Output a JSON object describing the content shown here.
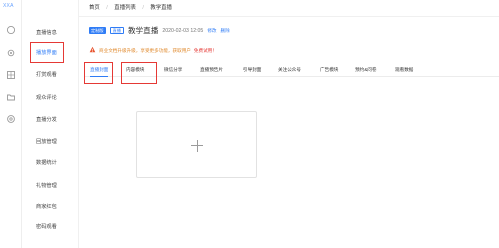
{
  "app": {
    "logo_text": "XXA"
  },
  "rail_icons": [
    "home-icon",
    "gear-icon",
    "grid-icon",
    "folder-icon",
    "settings-icon"
  ],
  "menu": {
    "items": [
      {
        "label": "直播信息"
      },
      {
        "label": "播放界面"
      },
      {
        "label": "打赏观看"
      },
      {
        "label": "观众评论"
      },
      {
        "label": "直播分发"
      },
      {
        "label": "回放管理"
      },
      {
        "label": "数据统计"
      },
      {
        "label": "礼物管理"
      },
      {
        "label": "商家红包"
      },
      {
        "label": "密码观看"
      }
    ],
    "active_index": 1
  },
  "breadcrumb": {
    "items": [
      "首页",
      "直播列表",
      "教学直播"
    ],
    "separator": "/"
  },
  "header": {
    "badge1": "定制版",
    "badge2": "直播",
    "title": "教学直播",
    "date": "2020-02-03 12:05",
    "edit_label": "修改",
    "delete_label": "删除"
  },
  "notice": {
    "icon": "warning-icon",
    "text": "商业文档升级升级，享受更多功能，获取用户",
    "link": "免费试用！"
  },
  "tabs": {
    "items": [
      "直播封面",
      "内容模块",
      "微信分享",
      "直播预告片",
      "引导封面",
      "关注公众号",
      "广告模块",
      "预约&问卷",
      "观看数据"
    ],
    "active_index": 0
  },
  "colors": {
    "accent": "#2f7cf6",
    "highlight": "#e53935"
  },
  "upload": {
    "icon": "plus-icon"
  }
}
